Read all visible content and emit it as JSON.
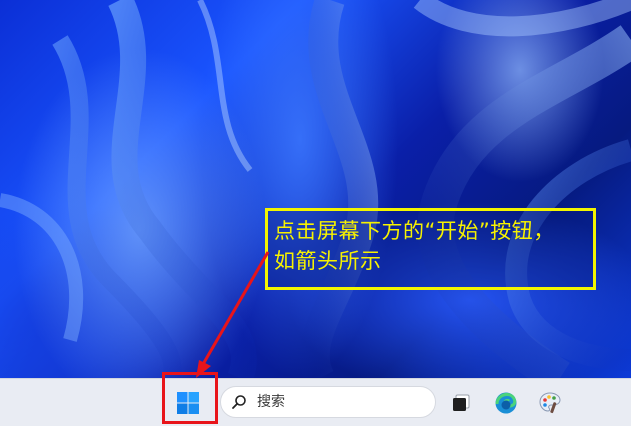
{
  "annotation": {
    "line1": "点击屏幕下方的“开始”按钮，",
    "line2": "如箭头所示",
    "text_color": "#f7f200",
    "border_color": "#f3f500"
  },
  "taskbar": {
    "start_icon": "windows-logo-icon",
    "search": {
      "placeholder": "搜索",
      "icon": "search-icon"
    },
    "apps": [
      {
        "name": "task-view-icon"
      },
      {
        "name": "edge-browser-icon"
      },
      {
        "name": "paint-app-icon"
      }
    ],
    "highlight_color": "#e8141a"
  },
  "wallpaper": {
    "theme": "Windows 11 bloom",
    "accent": "#1a55ff"
  }
}
